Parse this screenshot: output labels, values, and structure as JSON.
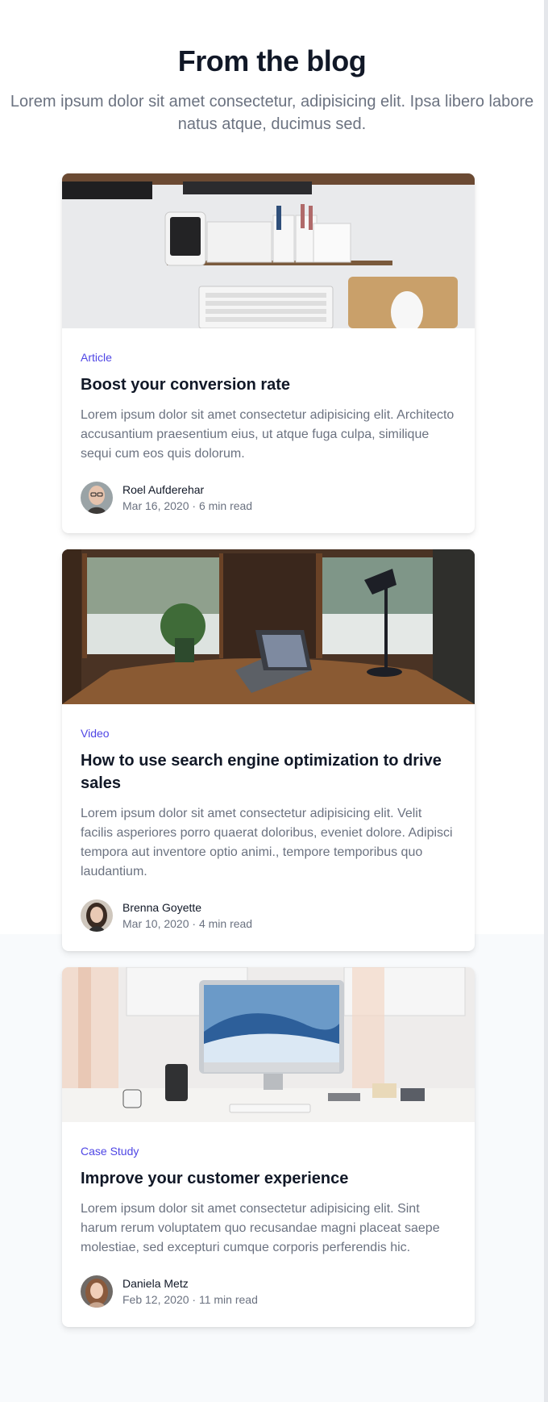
{
  "header": {
    "title": "From the blog",
    "subtitle": "Lorem ipsum dolor sit amet consectetur, adipisicing elit. Ipsa libero labore natus atque, ducimus sed."
  },
  "posts": [
    {
      "category": "Article",
      "title": "Boost your conversion rate",
      "description": "Lorem ipsum dolor sit amet consectetur adipisicing elit. Architecto accusantium praesentium eius, ut atque fuga culpa, similique sequi cum eos quis dolorum.",
      "author": "Roel Aufderehar",
      "date": "Mar 16, 2020",
      "separator": "·",
      "read_time": "6 min read"
    },
    {
      "category": "Video",
      "title": "How to use search engine optimization to drive sales",
      "description": "Lorem ipsum dolor sit amet consectetur adipisicing elit. Velit facilis asperiores porro quaerat doloribus, eveniet dolore. Adipisci tempora aut inventore optio animi., tempore temporibus quo laudantium.",
      "author": "Brenna Goyette",
      "date": "Mar 10, 2020",
      "separator": "·",
      "read_time": "4 min read"
    },
    {
      "category": "Case Study",
      "title": "Improve your customer experience",
      "description": "Lorem ipsum dolor sit amet consectetur adipisicing elit. Sint harum rerum voluptatem quo recusandae magni placeat saepe molestiae, sed excepturi cumque corporis perferendis hic.",
      "author": "Daniela Metz",
      "date": "Feb 12, 2020",
      "separator": "·",
      "read_time": "11 min read"
    }
  ],
  "colors": {
    "accent": "#4f46e5",
    "heading": "#111827",
    "muted": "#6b7280",
    "page_bg_bottom": "#f8fafc"
  }
}
